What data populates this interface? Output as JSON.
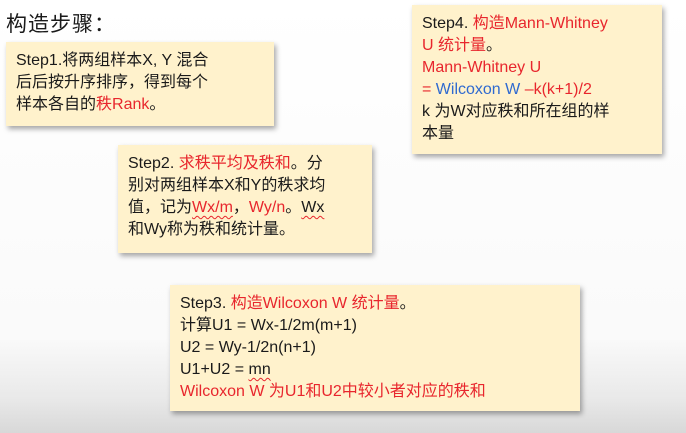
{
  "title": "构造步骤：",
  "step1": {
    "l1": "Step1.将两组样本X, Y 混合",
    "l2": "后后按升序排序，得到每个",
    "l3_a": "样本各自的",
    "l3_b": "秩Rank",
    "l3_c": "。"
  },
  "step2": {
    "l1_a": "Step2. ",
    "l1_b": "求秩平均及秩和",
    "l1_c": "。分",
    "l2": "别对两组样本X和Y的秩求均",
    "l3_a": "值，记为",
    "l3_b": "Wx/m",
    "l3_c": "，",
    "l3_d": "Wy/n",
    "l3_e": "。",
    "l3_f": "Wx",
    "l4": "和Wy称为秩和统计量。"
  },
  "step3": {
    "l1_a": "Step3. ",
    "l1_b": "构造Wilcoxon W 统计量",
    "l1_c": "。",
    "l2": "计算U1 = Wx-1/2m(m+1)",
    "l3": "U2 = Wy-1/2n(n+1)",
    "l4_a": "U1+U2 = ",
    "l4_b": "mn",
    "l5": "Wilcoxon W 为U1和U2中较小者对应的秩和"
  },
  "step4": {
    "l1_a": "Step4. ",
    "l1_b": "构造Mann-Whitney",
    "l2_a": "U 统计量",
    "l2_b": "。",
    "l3": "Mann-Whitney U",
    "l4_a": "= ",
    "l4_b": "Wilcoxon W",
    "l4_c": " –k(k+1)/2",
    "l5": "k 为W对应秩和所在组的样",
    "l6": "本量"
  },
  "colors": {
    "box_bg": "#fff2cc",
    "highlight_red": "#e8262d",
    "highlight_blue": "#2f6ad0"
  }
}
